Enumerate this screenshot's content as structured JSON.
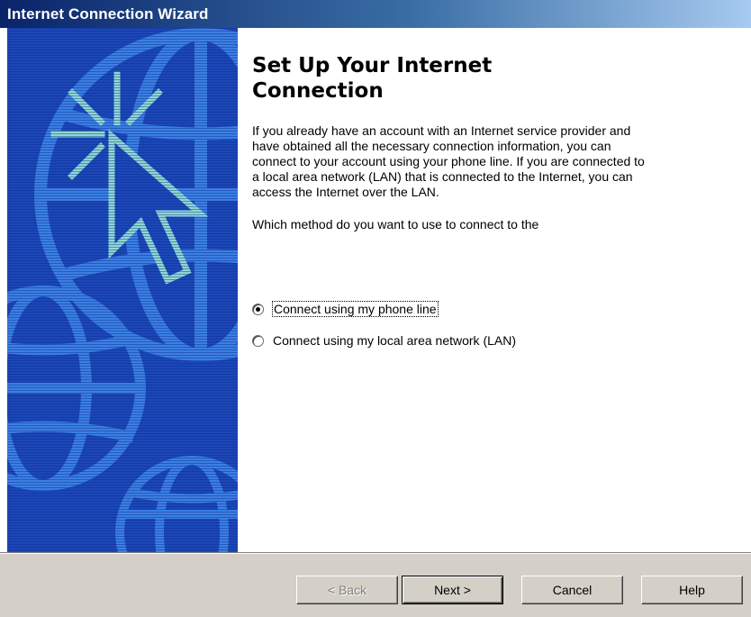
{
  "window": {
    "title": "Internet Connection Wizard"
  },
  "art": {
    "icon": "globe-cursor-illustration",
    "background_color": "#1c47b8"
  },
  "main": {
    "heading": "Set Up Your Internet Connection",
    "description": "If you already have an account with an Internet service provider and have obtained all the necessary connection information, you can connect to your account using your phone line. If you are connected to a local area network (LAN) that is connected to the Internet, you can access the Internet over the LAN.",
    "question": "Which method do you want to use to connect to the"
  },
  "options": {
    "phone_line": {
      "label": "Connect using my phone line",
      "selected": true
    },
    "lan": {
      "label": "Connect using my local area network (LAN)",
      "selected": false
    }
  },
  "buttons": {
    "back": {
      "label": "< Back",
      "enabled": false
    },
    "next": {
      "label": "Next >",
      "enabled": true,
      "default": true
    },
    "cancel": {
      "label": "Cancel",
      "enabled": true
    },
    "help": {
      "label": "Help",
      "enabled": true
    }
  }
}
